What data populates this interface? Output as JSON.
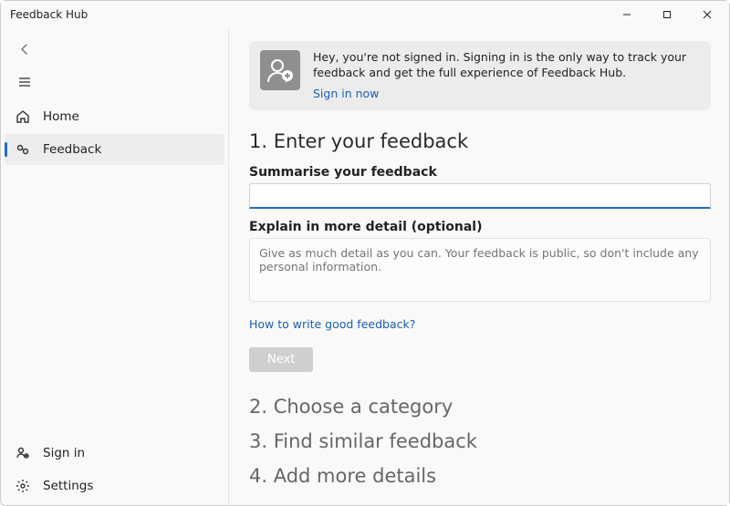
{
  "window": {
    "title": "Feedback Hub"
  },
  "sidebar": {
    "items": [
      {
        "label": "Home"
      },
      {
        "label": "Feedback"
      }
    ],
    "footer": [
      {
        "label": "Sign in"
      },
      {
        "label": "Settings"
      }
    ]
  },
  "banner": {
    "text": "Hey, you're not signed in. Signing in is the only way to track your feedback and get the full experience of Feedback Hub.",
    "link": "Sign in now"
  },
  "steps": {
    "s1": "1. Enter your feedback",
    "s2": "2. Choose a category",
    "s3": "3. Find similar feedback",
    "s4": "4. Add more details"
  },
  "form": {
    "summary_label": "Summarise your feedback",
    "summary_value": "",
    "detail_label": "Explain in more detail (optional)",
    "detail_placeholder": "Give as much detail as you can. Your feedback is public, so don't include any personal information.",
    "help_link": "How to write good feedback?",
    "next_label": "Next"
  }
}
